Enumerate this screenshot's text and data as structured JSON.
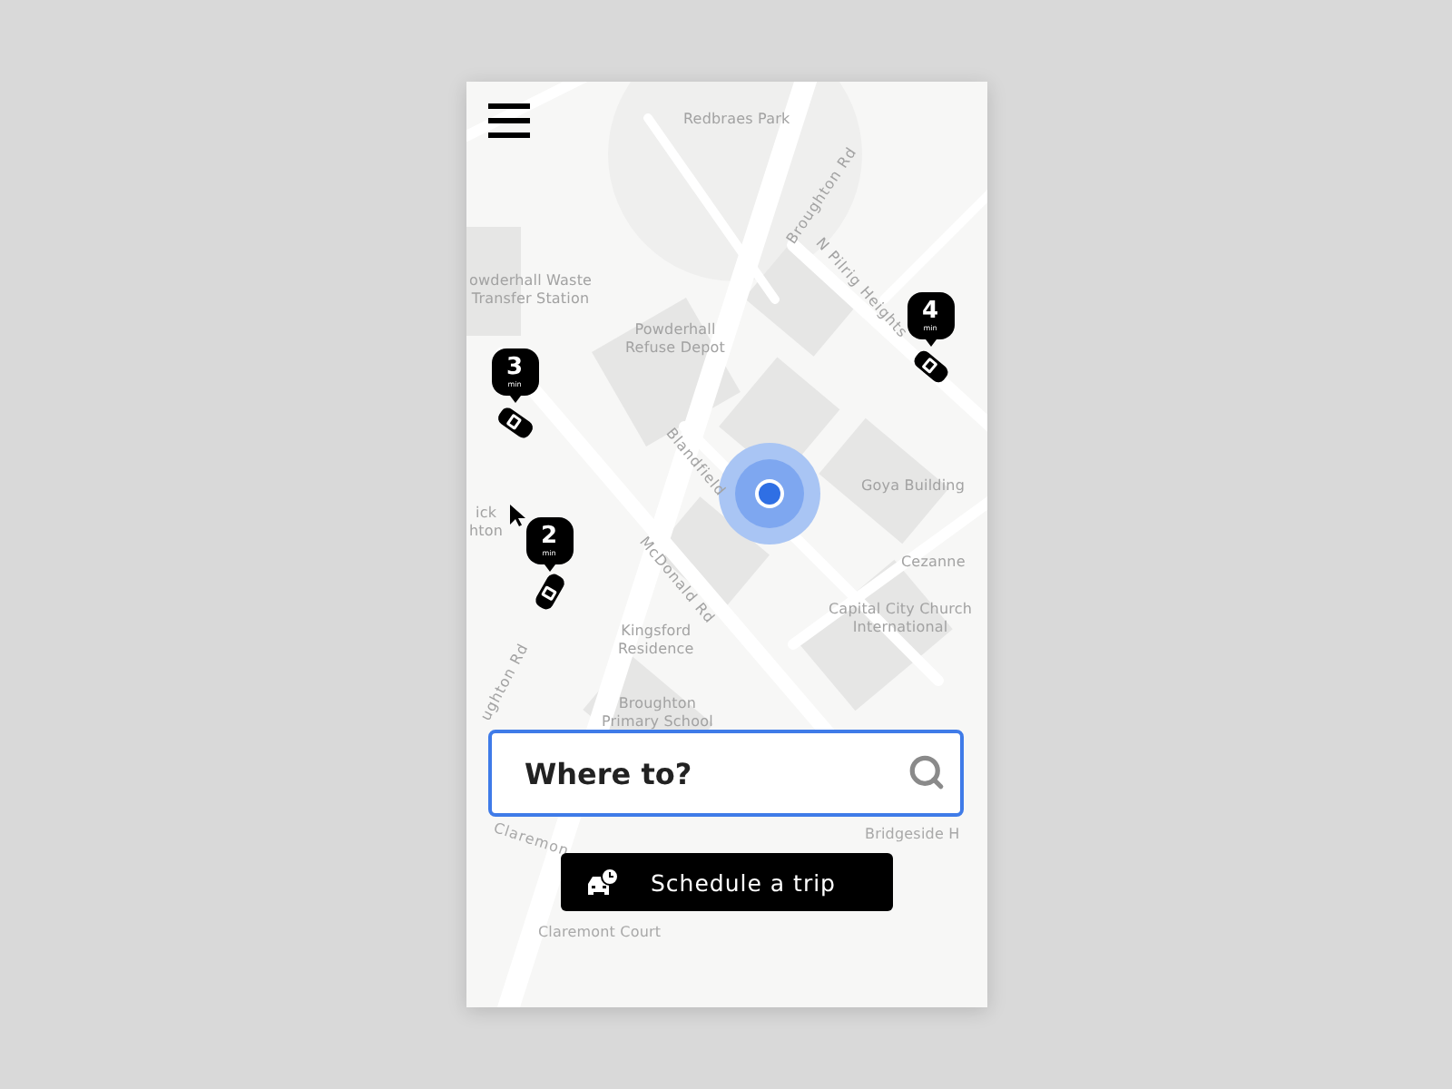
{
  "map_labels": [
    {
      "text": "Redbraes Park",
      "kind": "place"
    },
    {
      "text": "Broughton Rd",
      "kind": "road"
    },
    {
      "text": "N Pilrig Heights",
      "kind": "road"
    },
    {
      "text": "owderhall Waste\nTransfer Station",
      "kind": "place"
    },
    {
      "text": "Powderhall\nRefuse Depot",
      "kind": "place"
    },
    {
      "text": "Blandfield",
      "kind": "road"
    },
    {
      "text": "ick\nhton",
      "kind": "place"
    },
    {
      "text": "Goya Building",
      "kind": "place"
    },
    {
      "text": "McDonald Rd",
      "kind": "road"
    },
    {
      "text": "Cezanne",
      "kind": "place"
    },
    {
      "text": "Capital City Church\nInternational",
      "kind": "place"
    },
    {
      "text": "Kingsford\nResidence",
      "kind": "place"
    },
    {
      "text": "ughton Rd",
      "kind": "road"
    },
    {
      "text": "Broughton\nPrimary School",
      "kind": "place"
    },
    {
      "text": "Bridgeside H",
      "kind": "place"
    },
    {
      "text": "Claremon",
      "kind": "road"
    },
    {
      "text": "Claremont Court",
      "kind": "place"
    }
  ],
  "cars": [
    {
      "eta": "3",
      "unit": "min"
    },
    {
      "eta": "4",
      "unit": "min"
    },
    {
      "eta": "2",
      "unit": "min"
    }
  ],
  "search": {
    "placeholder": "Where to?"
  },
  "schedule_button": {
    "label": "Schedule a trip"
  }
}
